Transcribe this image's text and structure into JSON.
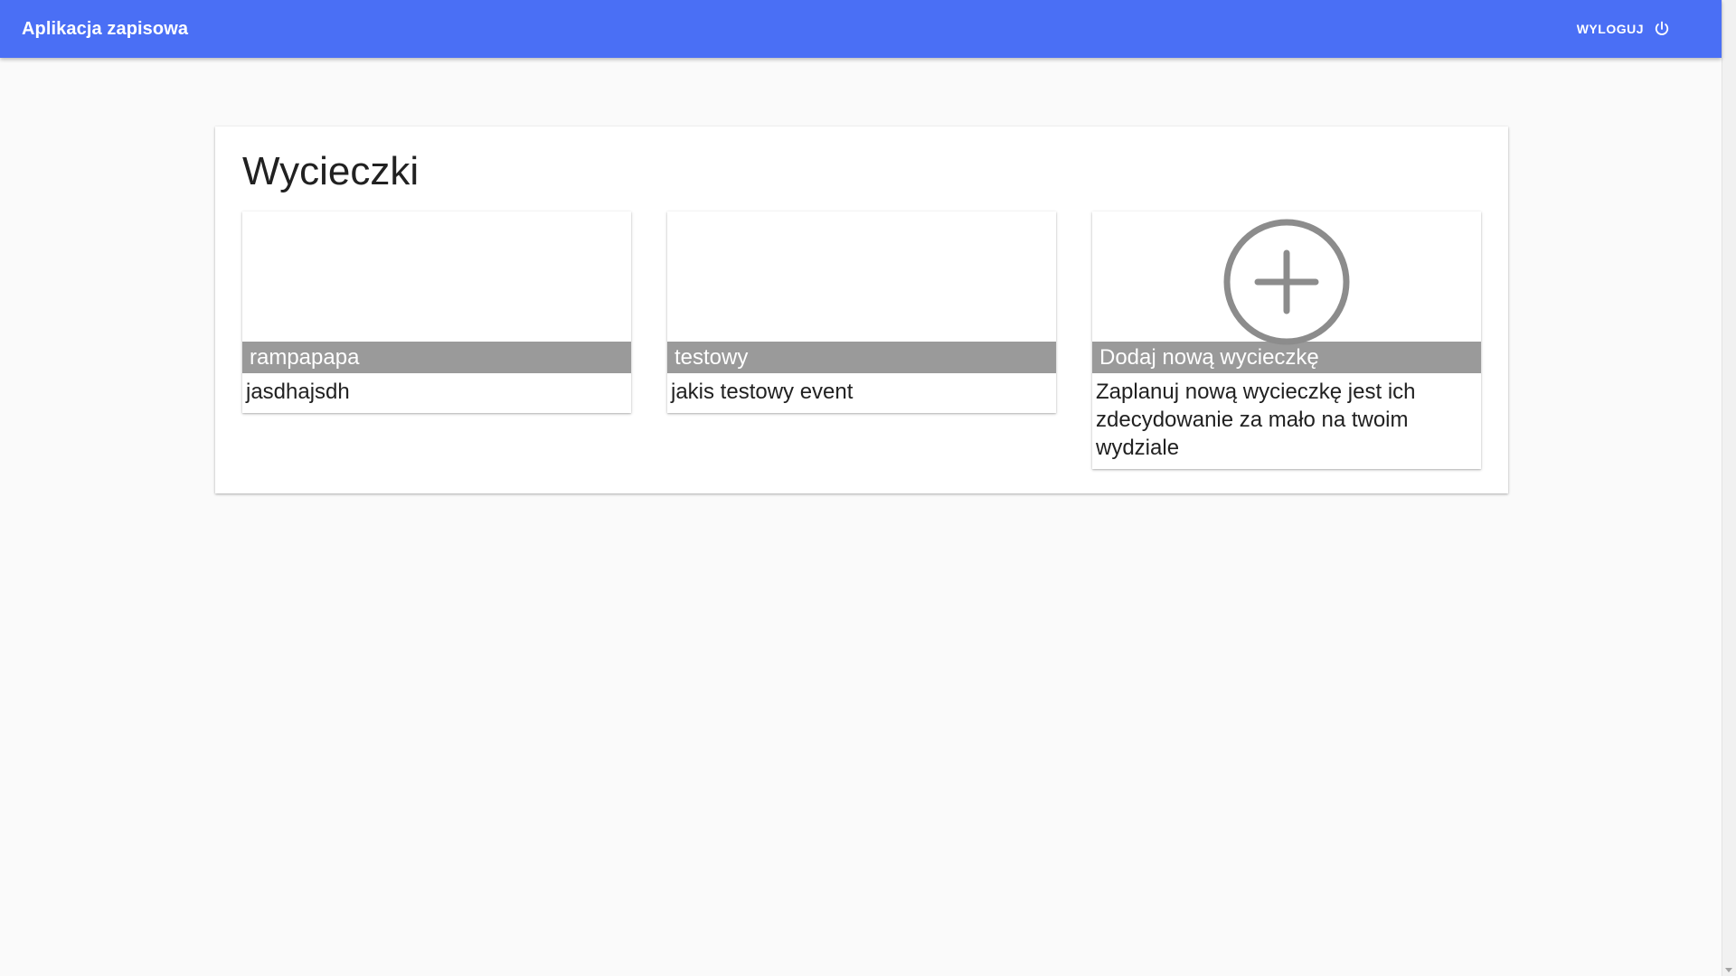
{
  "app": {
    "title": "Aplikacja zapisowa",
    "accent_color": "#4a6ff5",
    "logout_label": "WYLOGUJ",
    "logout_icon": "power-icon"
  },
  "page": {
    "title": "Wycieczki"
  },
  "cards": [
    {
      "title": "rampapapa",
      "description": "jasdhajsdh"
    },
    {
      "title": "testowy",
      "description": "jakis testowy event"
    },
    {
      "title": "Dodaj nową wycieczkę",
      "description": "Zaplanuj nową wycieczkę jest ich zdecydowanie za mało na twoim wydziale",
      "icon": "add-circle-icon"
    }
  ]
}
